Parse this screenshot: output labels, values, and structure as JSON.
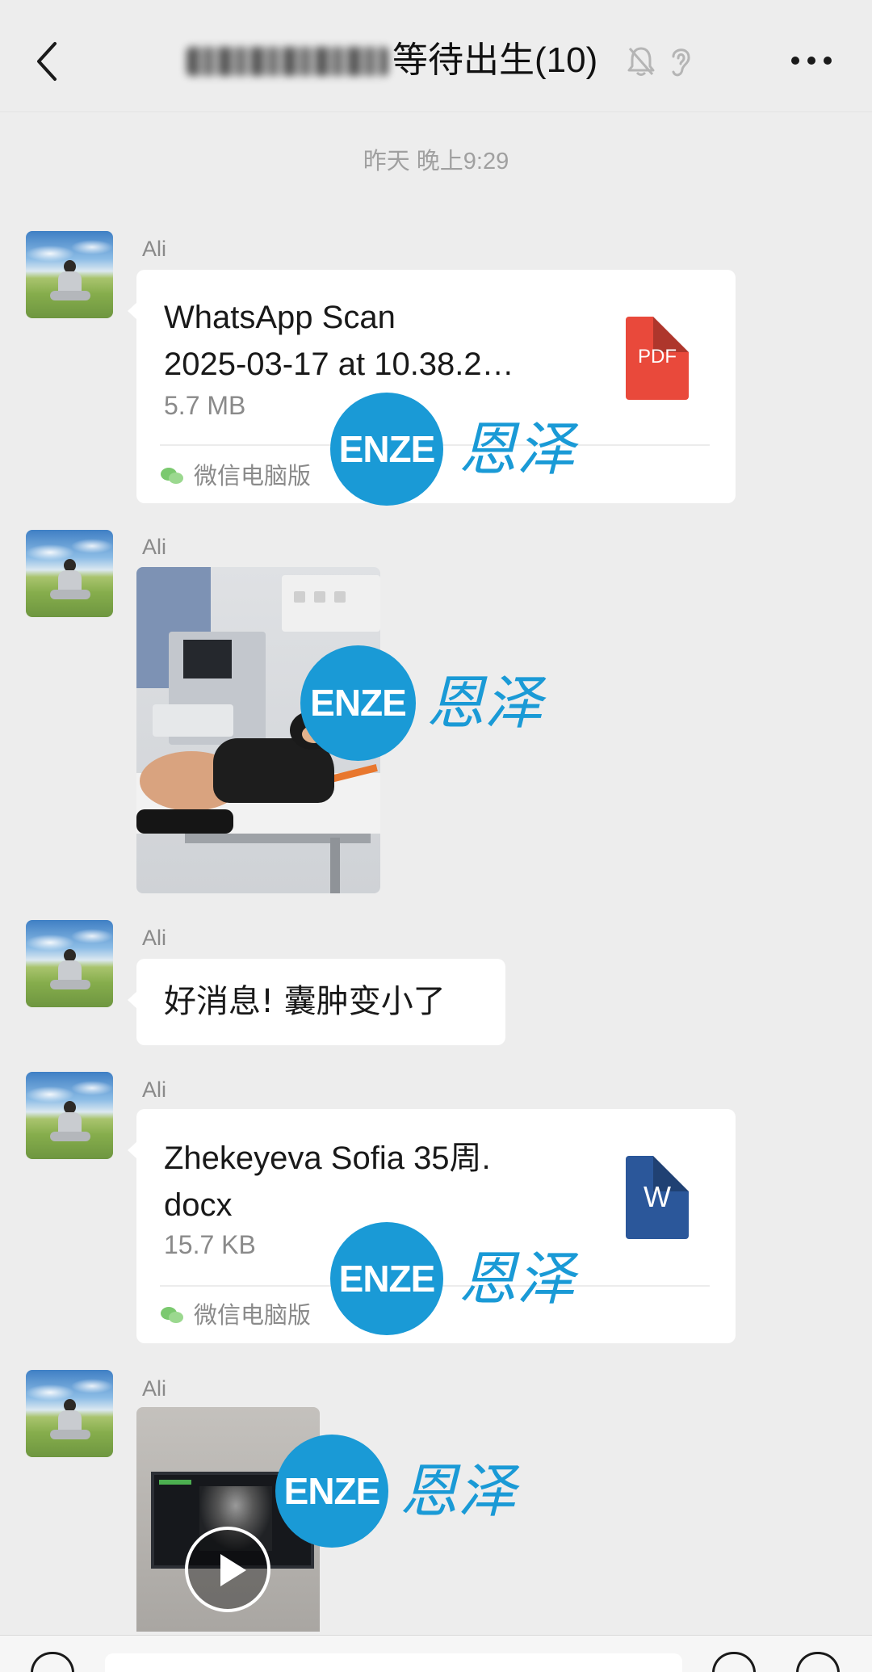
{
  "header": {
    "title": "等待出生(10)",
    "back_icon": "chevron-left-icon",
    "mute_icon": "bell-muted-icon",
    "earpiece_icon": "ear-icon",
    "more_icon": "more-icon"
  },
  "timestamp": "昨天 晚上9:29",
  "messages": [
    {
      "sender": "Ali",
      "type": "file",
      "name_lines": [
        "WhatsApp Scan",
        "2025-03-17 at 10.38.2…"
      ],
      "size": "5.7 MB",
      "file_icon_label": "PDF",
      "source": "微信电脑版"
    },
    {
      "sender": "Ali",
      "type": "image"
    },
    {
      "sender": "Ali",
      "type": "text",
      "text": "好消息! 囊肿变小了"
    },
    {
      "sender": "Ali",
      "type": "file",
      "name_lines": [
        "Zhekeyeva Sofia 35周.",
        "docx"
      ],
      "size": "15.7 KB",
      "file_icon_label": "W",
      "source": "微信电脑版"
    },
    {
      "sender": "Ali",
      "type": "video"
    }
  ],
  "watermark": {
    "logo": "ENZE",
    "text": "恩泽"
  },
  "colors": {
    "background": "#ededed",
    "bubble": "#ffffff",
    "watermark_blue": "#1a9ad6",
    "pdf_red": "#e9493b",
    "word_blue": "#2b579a"
  }
}
